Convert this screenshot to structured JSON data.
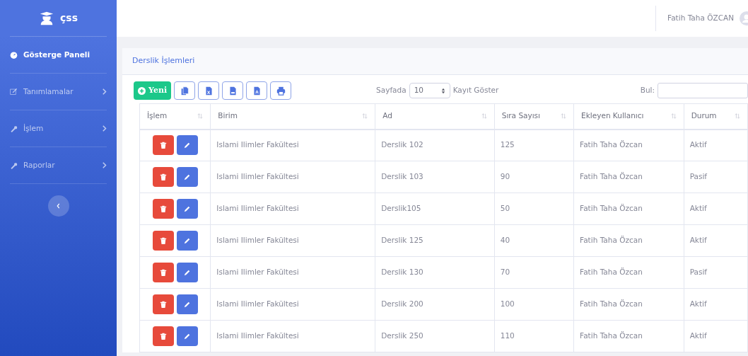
{
  "brand": {
    "name": "çss"
  },
  "sidebar": {
    "items": [
      {
        "label": "Gösterge Paneli",
        "kind": "link",
        "selected": true
      },
      {
        "label": "Tanımlamalar",
        "kind": "menu",
        "selected": false
      },
      {
        "label": "İşlem",
        "kind": "menu",
        "selected": false
      },
      {
        "label": "Raporlar",
        "kind": "menu",
        "selected": false
      }
    ]
  },
  "topbar": {
    "user": "Fatih Taha ÖZCAN"
  },
  "card": {
    "title": "Derslik İşlemleri",
    "new_button": "Yeni",
    "page_size": {
      "before": "Sayfada",
      "value": "10",
      "after": "Kayıt Göster"
    },
    "search": {
      "label": "Bul:"
    },
    "table": {
      "action_column": "İşlem",
      "columns": [
        "Birim",
        "Ad",
        "Sıra Sayısı",
        "Ekleyen Kullanıcı",
        "Durum"
      ],
      "rows": [
        [
          "Islami Ilimler Fakültesi",
          "Derslik 102",
          "125",
          "Fatih Taha Özcan",
          "Aktif"
        ],
        [
          "Islami Ilimler Fakültesi",
          "Derslik 103",
          "90",
          "Fatih Taha Özcan",
          "Pasif"
        ],
        [
          "Islami Ilimler Fakültesi",
          "Derslik105",
          "50",
          "Fatih Taha Özcan",
          "Aktif"
        ],
        [
          "Islami Ilimler Fakültesi",
          "Derslik 125",
          "40",
          "Fatih Taha Özcan",
          "Aktif"
        ],
        [
          "Islami Ilimler Fakültesi",
          "Derslik 130",
          "70",
          "Fatih Taha Özcan",
          "Pasif"
        ],
        [
          "Islami Ilimler Fakültesi",
          "Derslik 200",
          "100",
          "Fatih Taha Özcan",
          "Aktif"
        ],
        [
          "Islami Ilimler Fakültesi",
          "Derslik 250",
          "110",
          "Fatih Taha Özcan",
          "Aktif"
        ]
      ]
    }
  }
}
